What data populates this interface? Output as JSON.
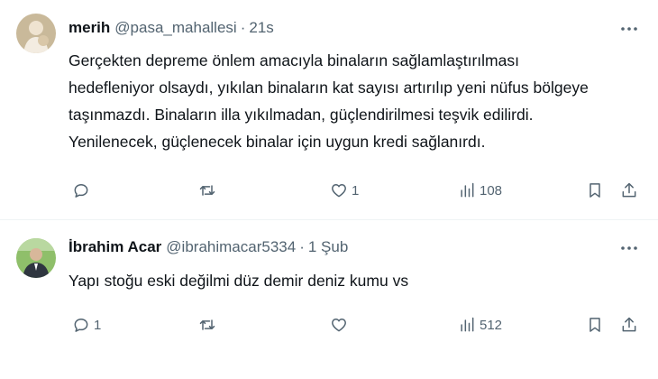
{
  "colors": {
    "text": "#0f1419",
    "secondary": "#536471",
    "divider": "#eff3f4",
    "background": "#ffffff"
  },
  "tweets": [
    {
      "name": "merih",
      "handle": "@pasa_mahallesi",
      "dot": "·",
      "time": "21s",
      "text_lines": [
        "Gerçekten depreme önlem amacıyla binaların sağlamlaştırılması",
        "hedefleniyor olsaydı, yıkılan binaların kat sayısı artırılıp yeni nüfus bölgeye",
        "taşınmazdı. Binaların illa yıkılmadan, güçlendirilmesi teşvik edilirdi.",
        "Yenilenecek, güçlenecek binalar için uygun kredi sağlanırdı."
      ],
      "replies": "",
      "retweets": "",
      "likes": "1",
      "views": "108",
      "icons": [
        "reply-icon",
        "retweet-icon",
        "heart-icon",
        "views-icon",
        "bookmark-icon",
        "share-icon",
        "more-icon"
      ]
    },
    {
      "name": "İbrahim Acar",
      "handle": "@ibrahimacar5334",
      "dot": "·",
      "time": "1 Şub",
      "text_lines": [
        "Yapı stoğu eski değilmi düz demir deniz kumu vs"
      ],
      "replies": "1",
      "retweets": "",
      "likes": "",
      "views": "512",
      "icons": [
        "reply-icon",
        "retweet-icon",
        "heart-icon",
        "views-icon",
        "bookmark-icon",
        "share-icon",
        "more-icon"
      ]
    }
  ]
}
